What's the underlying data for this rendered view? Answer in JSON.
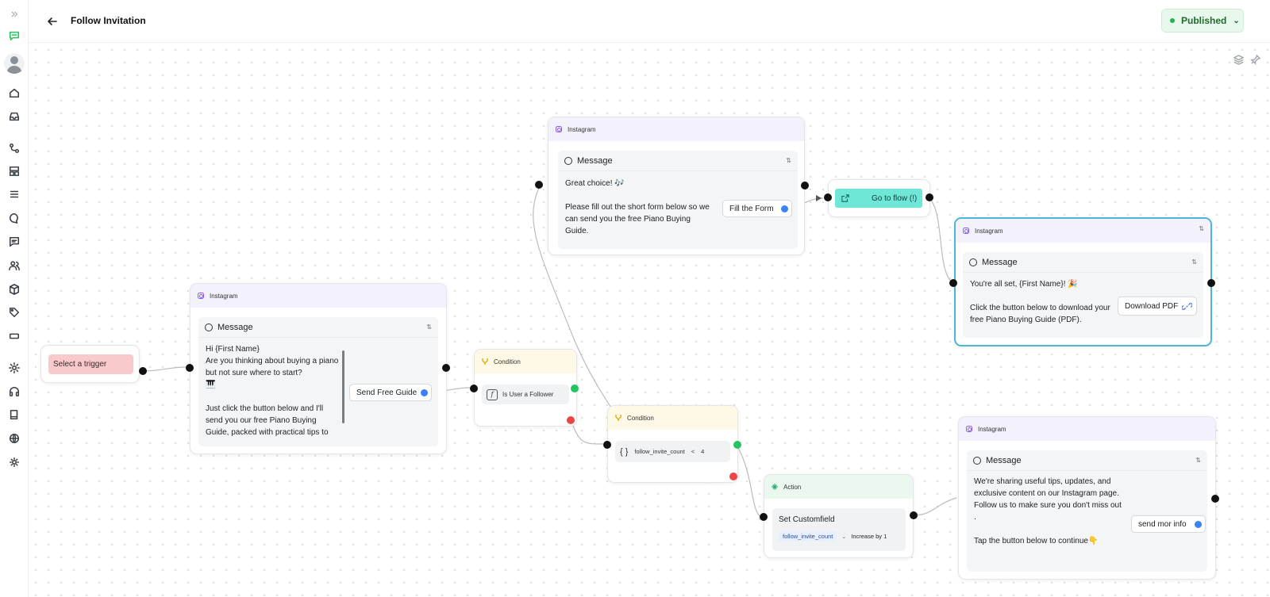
{
  "header": {
    "title": "Follow Invitation",
    "status": "Published"
  },
  "sidebar": {
    "items": [
      "collapse-icon",
      "chat-bot-icon",
      "home-icon",
      "inbox-icon",
      "flows-icon",
      "templates-icon",
      "list-icon",
      "chat-icon",
      "messages-icon",
      "contacts-icon",
      "box-icon",
      "tag-icon",
      "ticket-icon",
      "settings-icon",
      "headset-icon",
      "book-icon",
      "globe-icon",
      "sun-icon"
    ]
  },
  "nodes": {
    "trigger": {
      "label": "Select a trigger"
    },
    "ig1": {
      "header": "Instagram",
      "card_title": "Message",
      "text": "Hi {First Name}\nAre you thinking about buying a piano but not sure where to start?\n🎹\n\nJust click the button below and I'll send you our free Piano Buying Guide, packed with practical tips to",
      "button": "Send Free Guide"
    },
    "ig2": {
      "header": "Instagram",
      "card_title": "Message",
      "text": "Great choice! 🎶\n\nPlease fill out the short form below so we can send you the free Piano Buying Guide.",
      "button": "Fill the Form"
    },
    "goto": {
      "label": "Go to flow (!)"
    },
    "ig3": {
      "header": "Instagram",
      "card_title": "Message",
      "text": "You're all set, {First Name}! 🎉\n\nClick the button below to download your free Piano Buying Guide (PDF).",
      "button": "Download PDF"
    },
    "cond1": {
      "header": "Condition",
      "rule": "Is User a Follower"
    },
    "cond2": {
      "header": "Condition",
      "field": "follow_invite_count",
      "operator": "<",
      "value": "4",
      "brace": "{ }"
    },
    "action": {
      "header": "Action",
      "title": "Set Customfield",
      "field": "follow_invite_count",
      "operation": "Increase by 1"
    },
    "ig4": {
      "header": "Instagram",
      "card_title": "Message",
      "text": "We're sharing useful tips, updates, and exclusive content on our Instagram page.\nFollow us to make sure you don't miss out .\n\nTap the button below to continue👇",
      "button": "send mor info"
    }
  },
  "colors": {
    "published_bg": "#e9f8ec",
    "trigger_bg": "#f9c9cc",
    "goto_bg": "#6ee7d8",
    "selected_border": "#4bb7d8"
  }
}
